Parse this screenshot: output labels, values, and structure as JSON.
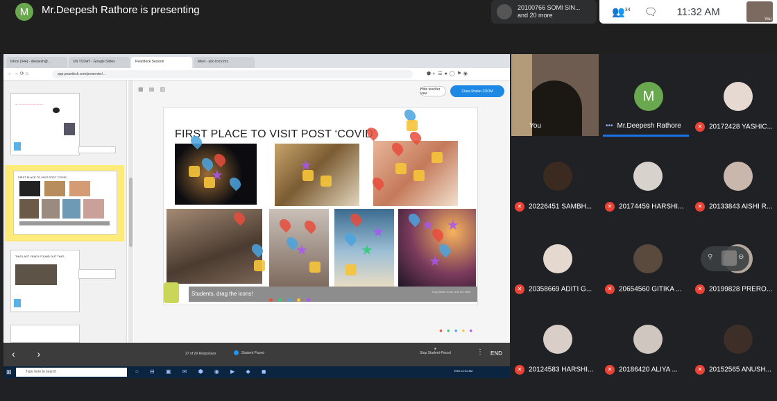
{
  "topbar": {
    "presenter_initial": "M",
    "presenter_text": "Mr.Deepesh Rathore is presenting",
    "notif_line1": "20100766 SOMI SIN...",
    "notif_line2": "and 20 more",
    "people_count": "34",
    "time": "11:32 AM",
    "self_label": "You"
  },
  "browser": {
    "tabs": [
      "Inbox (344) - deepesh@...",
      "UN TODAY - Google Slides",
      "Pearldeck Session",
      "Meet - abc-hxcx-hrz"
    ],
    "url": "app.peardeck.com/presenter/..."
  },
  "slides_panel": {
    "thumb1_title": "",
    "thumb2_title": "FIRST PLACE TO VISIT POST 'COVID'",
    "thumb3_title": "THIS LAST YEAR I FOUND OUT THAT..."
  },
  "presenter_controls": {
    "btn_light": "Hide teacher view",
    "btn_blue": "Class Roster ZOOM"
  },
  "slide": {
    "title": "FIRST PLACE TO VISIT POST ‘COVID’",
    "drag_label": "Students, drag the icons!",
    "hint": "Drag these icons onto the slide"
  },
  "deck_bar": {
    "responses": "27 of 29 Responses",
    "paced": "Student Paced",
    "stop": "Stop Student-Paced",
    "end": "END"
  },
  "taskbar": {
    "search": "Type here to search",
    "tray": "ENG 11:32 AM"
  },
  "participants": {
    "you": "You",
    "host": "Mr.Deepesh Rathore",
    "host_initial": "M",
    "p1": "20172428 YASHIC...",
    "p2": "20226451 SAMBH...",
    "p3": "20174459 HARSHI...",
    "p4": "20133843 AISHI R...",
    "p5": "20358669 ADITI G...",
    "p6": "20654560 GITIKA ...",
    "p7": "20199828 PRERO...",
    "p8": "20124583 HARSHI...",
    "p9": "20186420 ALIYA ...",
    "p10": "20152565 ANUSH..."
  },
  "colors": {
    "meet_bg": "#202124",
    "accent_blue": "#1a73e8",
    "mic_off_red": "#ea4335",
    "host_green": "#6aa84f"
  }
}
